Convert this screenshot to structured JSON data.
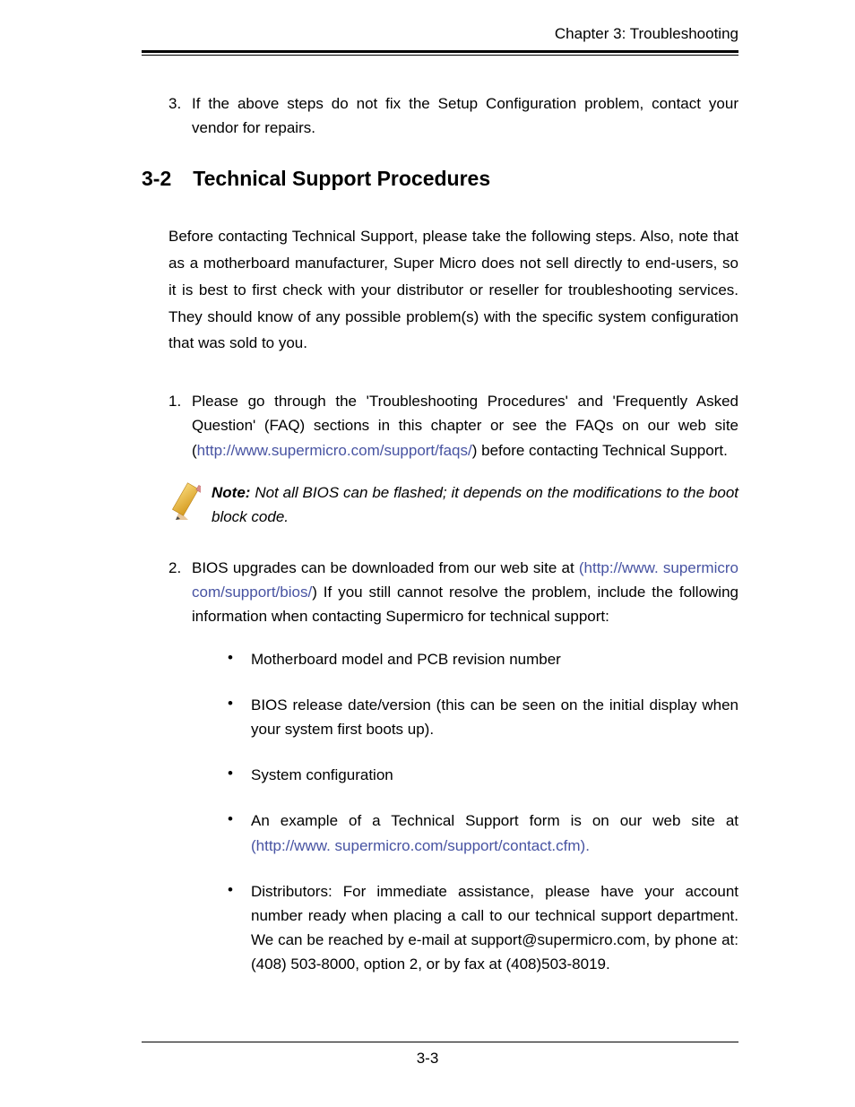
{
  "header": {
    "chapter_label": "Chapter 3: Troubleshooting"
  },
  "top_list": {
    "item3": {
      "num": "3.",
      "text": "If the above steps do not fix the Setup Configuration problem, contact your vendor for repairs."
    }
  },
  "section": {
    "num": "3-2",
    "title": "Technical Support Procedures"
  },
  "intro": "Before contacting Technical Support, please take the following steps. Also, note that as a motherboard manufacturer, Super Micro does not sell directly to end-users, so it is best to first check with your distributor or reseller for troubleshooting services. They should know of any possible problem(s) with the specific system configuration that was sold to you.",
  "steps": {
    "s1": {
      "num": "1.",
      "pre": "Please go through the 'Troubleshooting Procedures' and 'Frequently Asked Question' (FAQ) sections in this chapter or see the FAQs on our web site (",
      "link": "http://www.supermicro.com/support/faqs/",
      "post": ") before contacting Technical Support."
    },
    "note": {
      "label": "Note:",
      "text": " Not all BIOS can be flashed; it depends on the modifications to the boot block code."
    },
    "s2": {
      "num": "2.",
      "pre": "BIOS upgrades can be downloaded from our web site at ",
      "link_open": "(http://www.",
      "link_cont": "supermicro com/support/bios/",
      "post": ") If you still cannot resolve the problem, include the following information when contacting Supermicro for technical support:"
    }
  },
  "bullets": {
    "b1": "Motherboard model and PCB revision number",
    "b2": "BIOS release date/version (this can be seen on the initial display when your system first boots up).",
    "b3": "System configuration",
    "b4_pre": "An example of a Technical Support form is on our web site at ",
    "b4_link_open": "(http://www.",
    "b4_link_cont": "supermicro.com/support/contact.cfm).",
    "b5": "Distributors: For immediate assistance, please have your account number ready when placing a call to our technical support department. We can be reached by e-mail at support@supermicro.com, by phone at:(408) 503-8000, option 2, or by fax at (408)503-8019."
  },
  "footer": {
    "page_num": "3-3"
  }
}
